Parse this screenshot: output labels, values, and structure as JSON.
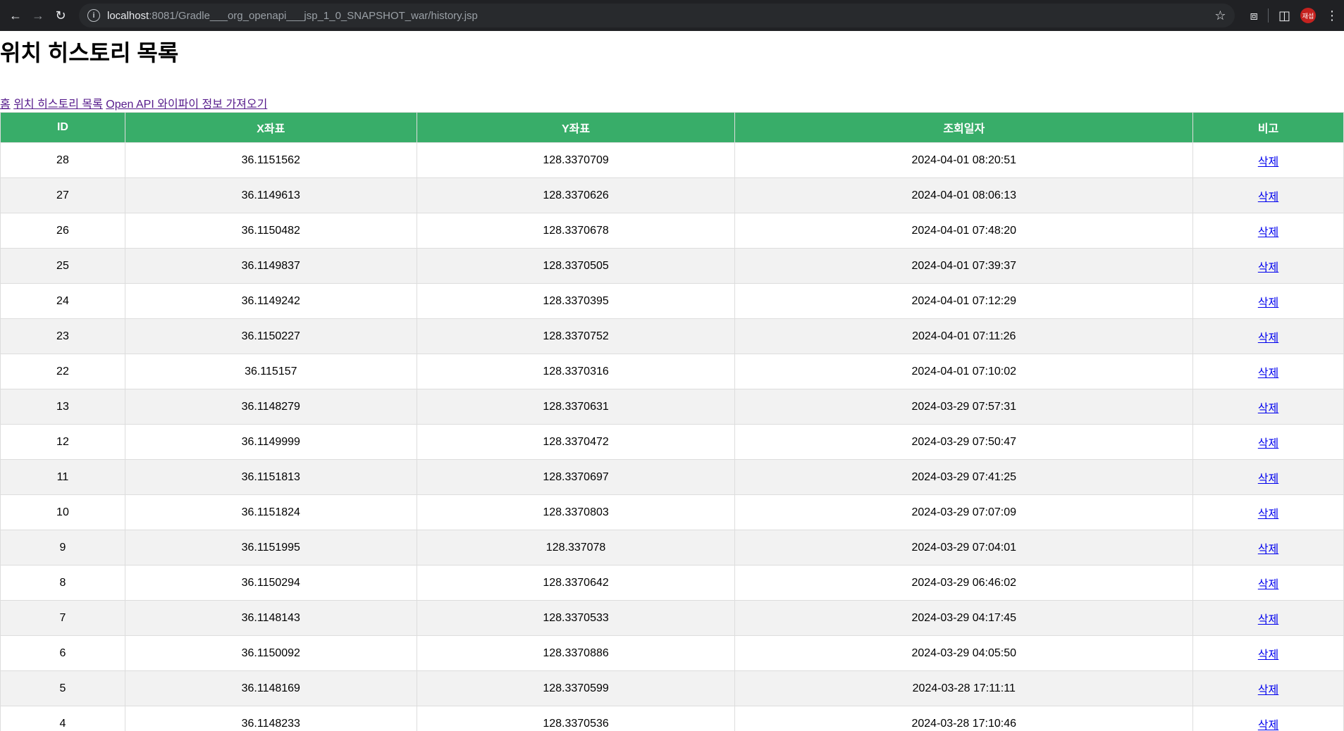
{
  "browser": {
    "url_host": "localhost",
    "url_path": ":8081/Gradle___org_openapi___jsp_1_0_SNAPSHOT_war/history.jsp",
    "profile_label": "재섭"
  },
  "page": {
    "title": "위치 히스토리 목록",
    "nav_links": [
      "홈",
      "위치 히스토리 목록",
      "Open API 와이파이 정보 가져오기"
    ]
  },
  "table": {
    "headers": [
      "ID",
      "X좌표",
      "Y좌표",
      "조회일자",
      "비고"
    ],
    "delete_label": "삭제",
    "rows": [
      {
        "id": "28",
        "x": "36.1151562",
        "y": "128.3370709",
        "date": "2024-04-01 08:20:51"
      },
      {
        "id": "27",
        "x": "36.1149613",
        "y": "128.3370626",
        "date": "2024-04-01 08:06:13"
      },
      {
        "id": "26",
        "x": "36.1150482",
        "y": "128.3370678",
        "date": "2024-04-01 07:48:20"
      },
      {
        "id": "25",
        "x": "36.1149837",
        "y": "128.3370505",
        "date": "2024-04-01 07:39:37"
      },
      {
        "id": "24",
        "x": "36.1149242",
        "y": "128.3370395",
        "date": "2024-04-01 07:12:29"
      },
      {
        "id": "23",
        "x": "36.1150227",
        "y": "128.3370752",
        "date": "2024-04-01 07:11:26"
      },
      {
        "id": "22",
        "x": "36.115157",
        "y": "128.3370316",
        "date": "2024-04-01 07:10:02"
      },
      {
        "id": "13",
        "x": "36.1148279",
        "y": "128.3370631",
        "date": "2024-03-29 07:57:31"
      },
      {
        "id": "12",
        "x": "36.1149999",
        "y": "128.3370472",
        "date": "2024-03-29 07:50:47"
      },
      {
        "id": "11",
        "x": "36.1151813",
        "y": "128.3370697",
        "date": "2024-03-29 07:41:25"
      },
      {
        "id": "10",
        "x": "36.1151824",
        "y": "128.3370803",
        "date": "2024-03-29 07:07:09"
      },
      {
        "id": "9",
        "x": "36.1151995",
        "y": "128.337078",
        "date": "2024-03-29 07:04:01"
      },
      {
        "id": "8",
        "x": "36.1150294",
        "y": "128.3370642",
        "date": "2024-03-29 06:46:02"
      },
      {
        "id": "7",
        "x": "36.1148143",
        "y": "128.3370533",
        "date": "2024-03-29 04:17:45"
      },
      {
        "id": "6",
        "x": "36.1150092",
        "y": "128.3370886",
        "date": "2024-03-29 04:05:50"
      },
      {
        "id": "5",
        "x": "36.1148169",
        "y": "128.3370599",
        "date": "2024-03-28 17:11:11"
      },
      {
        "id": "4",
        "x": "36.1148233",
        "y": "128.3370536",
        "date": "2024-03-28 17:10:46"
      }
    ]
  }
}
